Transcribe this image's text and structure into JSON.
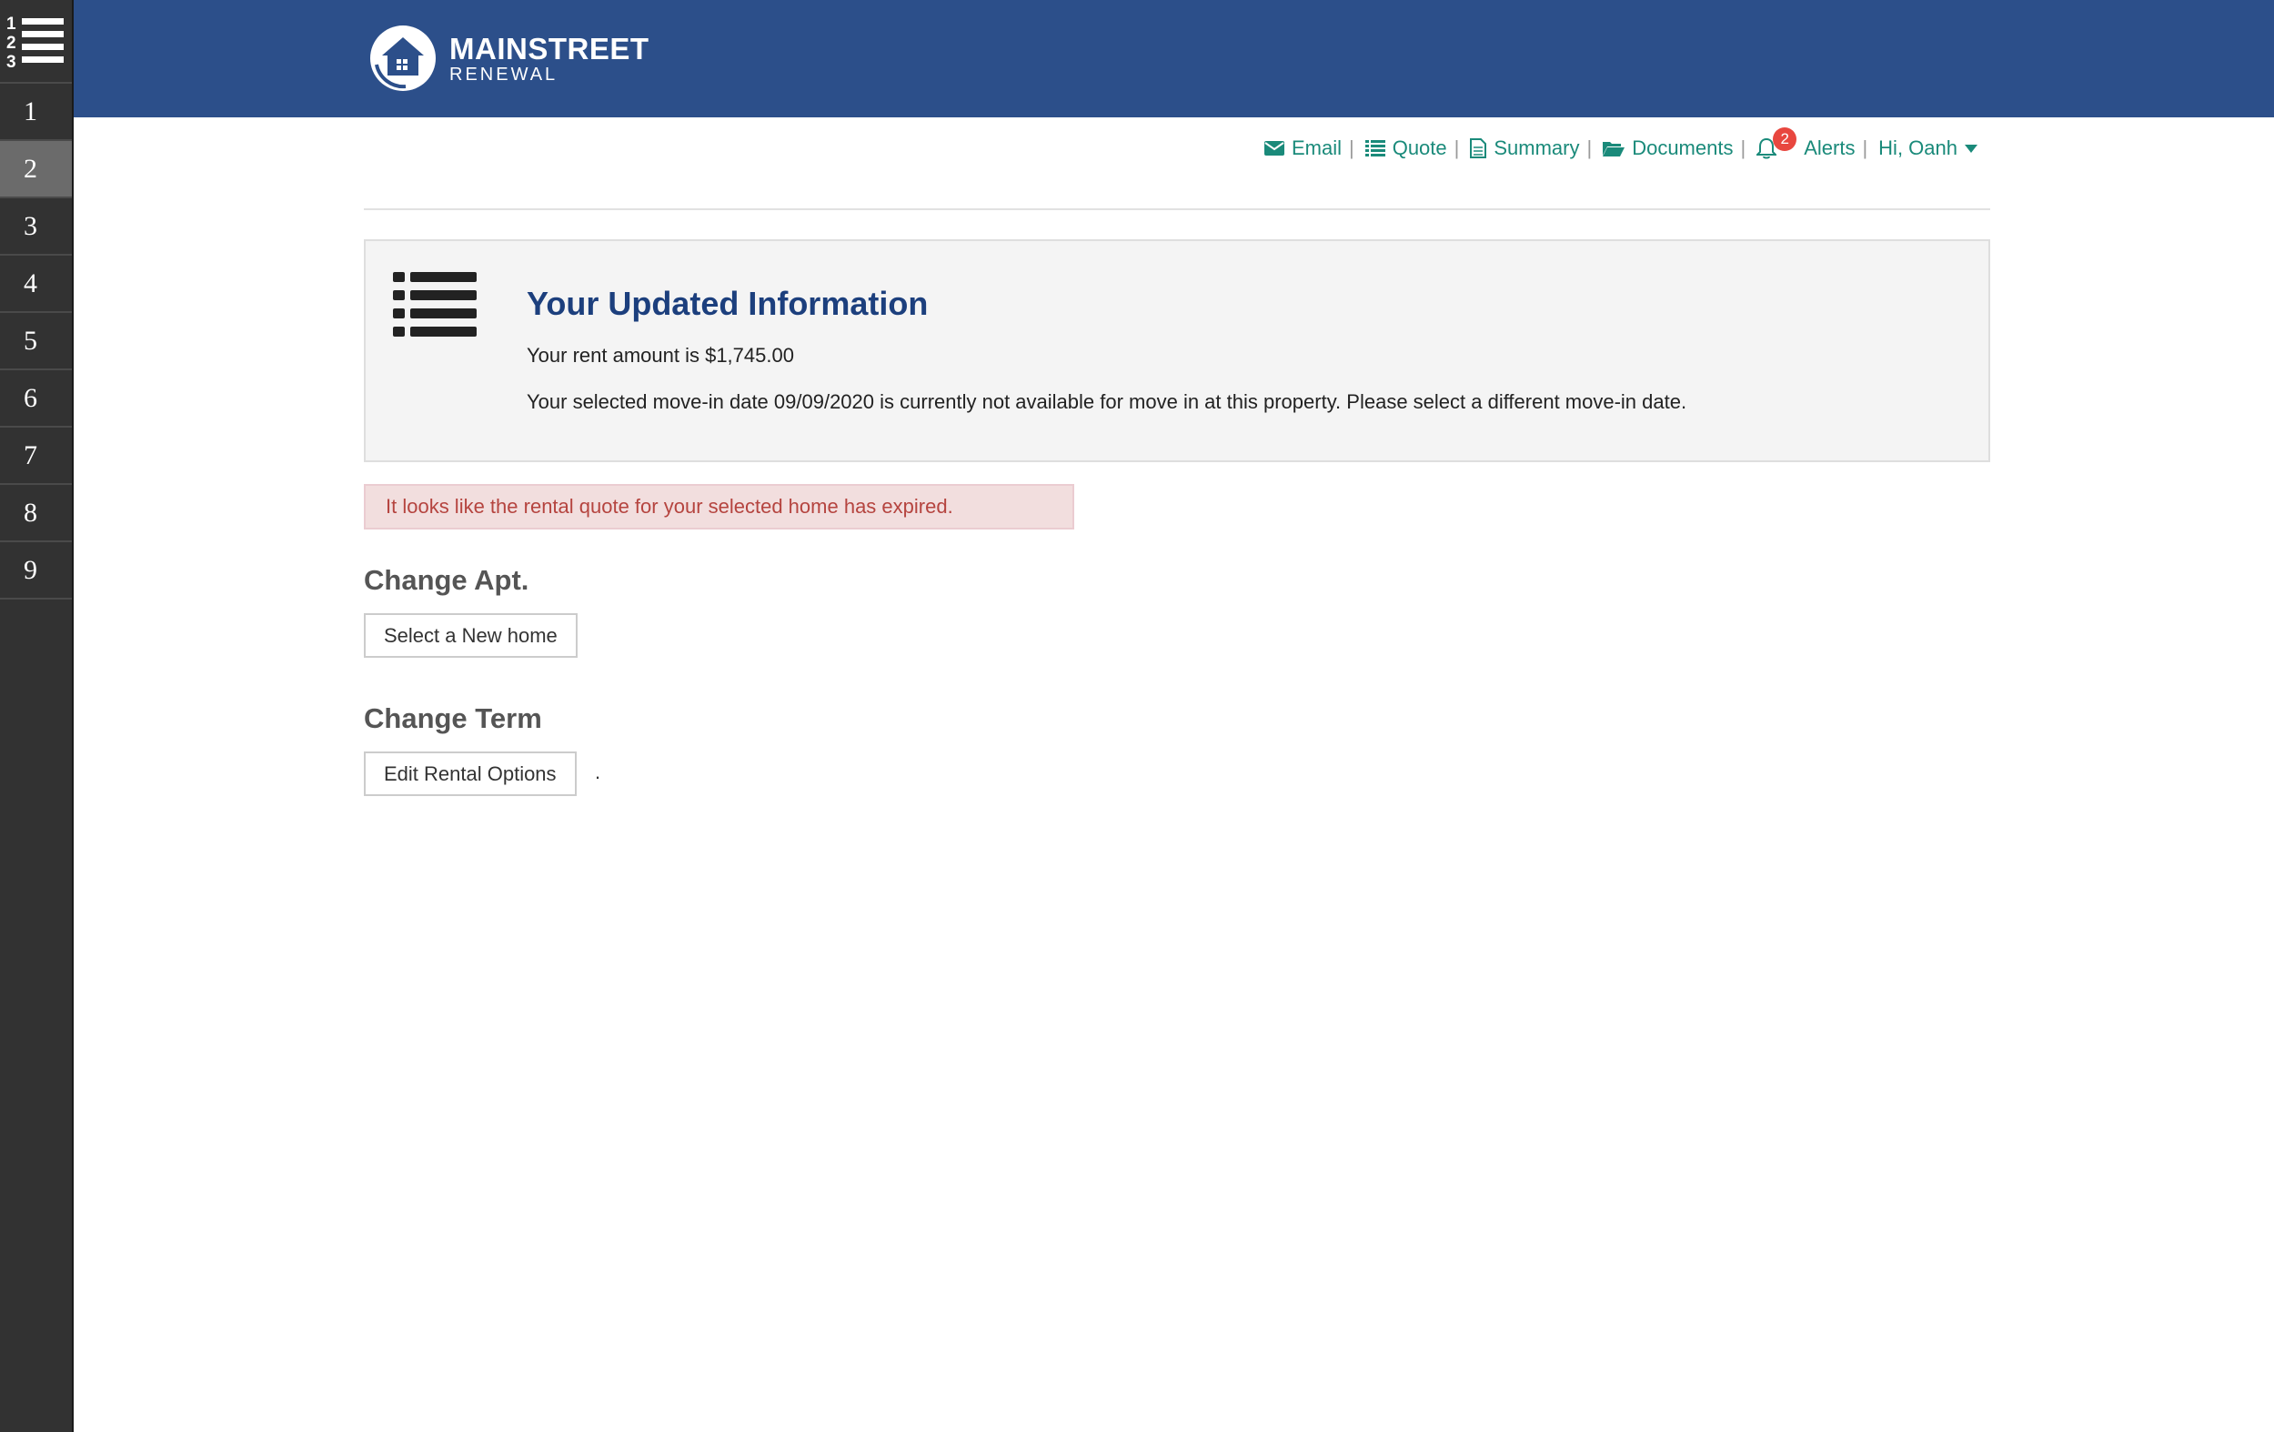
{
  "sidebar": {
    "steps": [
      "1",
      "2",
      "3",
      "4",
      "5",
      "6",
      "7",
      "8",
      "9"
    ],
    "active_step": "2"
  },
  "brand": {
    "name": "MAINSTREET",
    "sub": "RENEWAL",
    "color": "#2c4f8a"
  },
  "nav": {
    "email": "Email",
    "quote": "Quote",
    "summary": "Summary",
    "documents": "Documents",
    "alerts": "Alerts",
    "alert_count": "2",
    "user": "Hi, Oanh",
    "separator": "|",
    "link_color": "#1a8a7a"
  },
  "info": {
    "title": "Your Updated Information",
    "rent": "Your rent amount is $1,745.00",
    "move_in": "Your selected move-in date 09/09/2020 is currently not available for move in at this property. Please select a different move-in date."
  },
  "error": {
    "message": "It looks like the rental quote for your selected home has expired."
  },
  "change_apt": {
    "title": "Change Apt.",
    "button": "Select a New home"
  },
  "change_term": {
    "title": "Change Term",
    "button": "Edit Rental Options",
    "trailing": "."
  }
}
